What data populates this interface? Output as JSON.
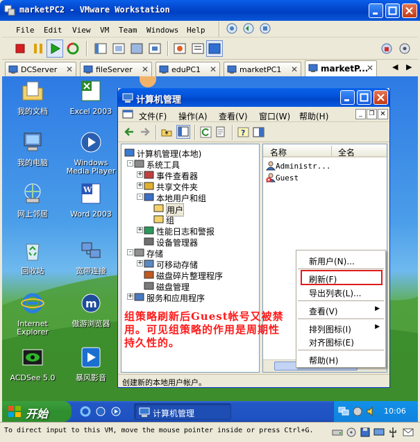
{
  "vmware": {
    "title": "marketPC2 - VMware Workstation",
    "menu": [
      "File",
      "Edit",
      "View",
      "VM",
      "Team",
      "Windows",
      "Help"
    ],
    "tabs": [
      {
        "label": "DCServer",
        "active": false
      },
      {
        "label": "fileServer",
        "active": false
      },
      {
        "label": "eduPC1",
        "active": false
      },
      {
        "label": "marketPC1",
        "active": false
      },
      {
        "label": "marketP...",
        "active": true
      }
    ],
    "status_text": "To direct input to this VM, move the mouse pointer inside or press Ctrl+G."
  },
  "desktop": {
    "icons": [
      {
        "label": "我的文档",
        "icon": "my-documents-icon"
      },
      {
        "label": "Excel 2003",
        "icon": "excel-icon"
      },
      {
        "label": "我的电脑",
        "icon": "my-computer-icon"
      },
      {
        "label": "Windows Media Player",
        "icon": "media-player-icon"
      },
      {
        "label": "网上邻居",
        "icon": "network-places-icon"
      },
      {
        "label": "Word 2003",
        "icon": "word-icon"
      },
      {
        "label": "回收站",
        "icon": "recycle-bin-icon"
      },
      {
        "label": "宽带连接",
        "icon": "broadband-icon"
      },
      {
        "label": "Internet Explorer",
        "icon": "ie-icon"
      },
      {
        "label": "傲游浏览器",
        "icon": "maxthon-icon"
      },
      {
        "label": "ACDSee 5.0",
        "icon": "acdsee-icon"
      },
      {
        "label": "暴风影音",
        "icon": "baofeng-icon"
      }
    ]
  },
  "cm": {
    "title": "计算机管理",
    "menu": [
      "文件(F)",
      "操作(A)",
      "查看(V)",
      "窗口(W)",
      "帮助(H)"
    ],
    "tree": [
      {
        "label": "计算机管理(本地)",
        "depth": 0,
        "expander": "",
        "icon": "computer-icon"
      },
      {
        "label": "系统工具",
        "depth": 1,
        "expander": "-",
        "icon": "tools-icon"
      },
      {
        "label": "事件查看器",
        "depth": 2,
        "expander": "+",
        "icon": "event-viewer-icon"
      },
      {
        "label": "共享文件夹",
        "depth": 2,
        "expander": "+",
        "icon": "shared-folder-icon"
      },
      {
        "label": "本地用户和组",
        "depth": 2,
        "expander": "-",
        "icon": "users-icon"
      },
      {
        "label": "用户",
        "depth": 3,
        "expander": "",
        "icon": "folder-icon",
        "selected": true
      },
      {
        "label": "组",
        "depth": 3,
        "expander": "",
        "icon": "folder-icon"
      },
      {
        "label": "性能日志和警报",
        "depth": 2,
        "expander": "+",
        "icon": "perf-logs-icon"
      },
      {
        "label": "设备管理器",
        "depth": 2,
        "expander": "",
        "icon": "device-manager-icon"
      },
      {
        "label": "存储",
        "depth": 1,
        "expander": "-",
        "icon": "storage-icon"
      },
      {
        "label": "可移动存储",
        "depth": 2,
        "expander": "+",
        "icon": "removable-storage-icon"
      },
      {
        "label": "磁盘碎片整理程序",
        "depth": 2,
        "expander": "",
        "icon": "defrag-icon"
      },
      {
        "label": "磁盘管理",
        "depth": 2,
        "expander": "",
        "icon": "disk-management-icon"
      },
      {
        "label": "服务和应用程序",
        "depth": 1,
        "expander": "+",
        "icon": "services-icon"
      }
    ],
    "list_headers": [
      "名称",
      "全名"
    ],
    "list_rows": [
      {
        "name": "Administr...",
        "disabled": false
      },
      {
        "name": "Guest",
        "disabled": true
      }
    ],
    "status": "创建新的本地用户帐户。"
  },
  "annotation": "组策略刷新后Guest帐号又被禁用。可见组策略的作用是周期性持久性的。",
  "context_menu": {
    "items": [
      {
        "label": "新用户(N)...",
        "submenu": false
      },
      {
        "label": "刷新(F)",
        "submenu": false
      },
      {
        "label": "导出列表(L)...",
        "submenu": false
      },
      {
        "label": "查看(V)",
        "submenu": true
      },
      {
        "label": "排列图标(I)",
        "submenu": true
      },
      {
        "label": "对齐图标(E)",
        "submenu": false
      },
      {
        "label": "帮助(H)",
        "submenu": false
      }
    ]
  },
  "taskbar": {
    "start_label": "开始",
    "task_label": "计算机管理",
    "clock": "10:06"
  }
}
